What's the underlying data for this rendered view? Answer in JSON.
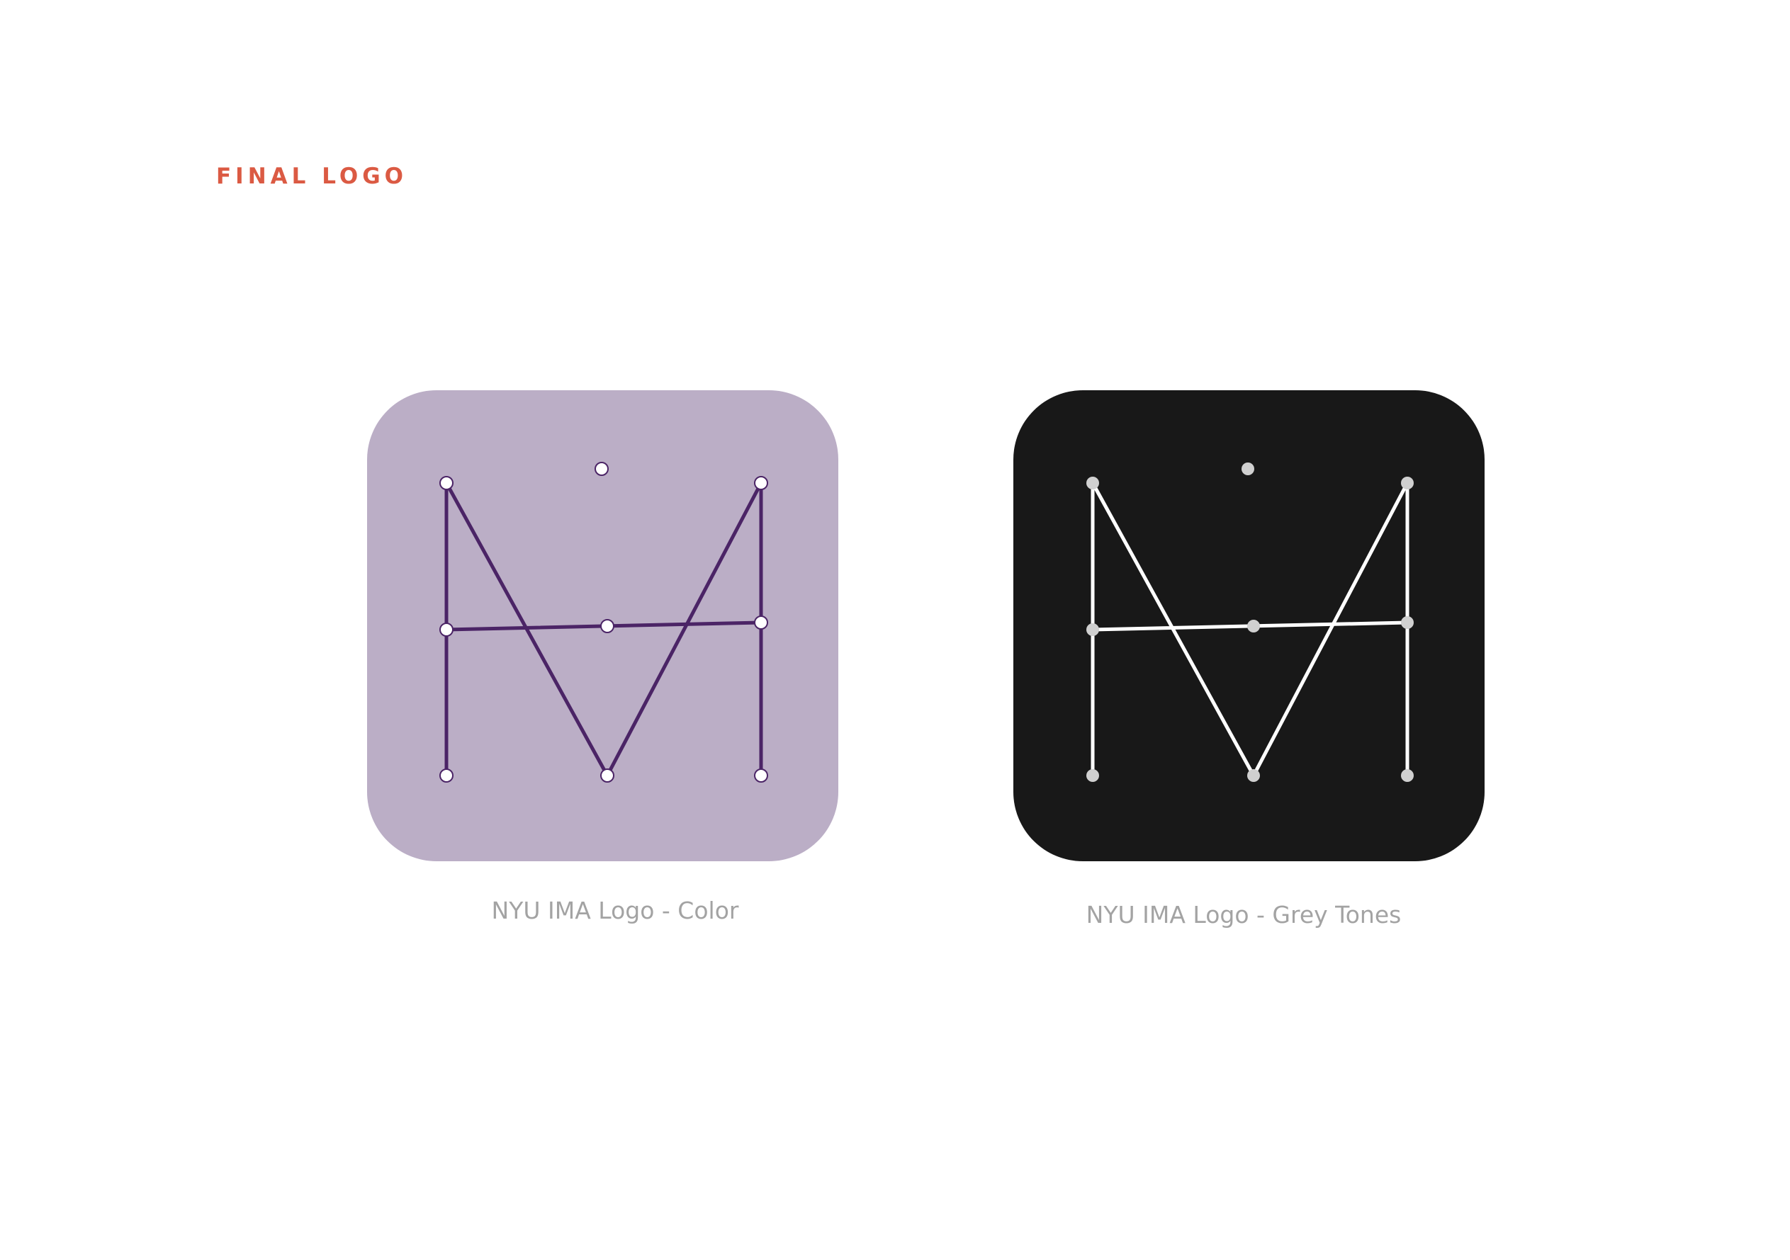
{
  "heading": "FINAL LOGO",
  "logos": [
    {
      "caption": "NYU IMA Logo - Color",
      "background": "#bbaec6",
      "stroke": "#4b2466",
      "dot": "#ffffff"
    },
    {
      "caption": "NYU IMA Logo - Grey Tones",
      "background": "#181818",
      "stroke": "#ffffff",
      "dot": "#d0d0d0"
    }
  ]
}
